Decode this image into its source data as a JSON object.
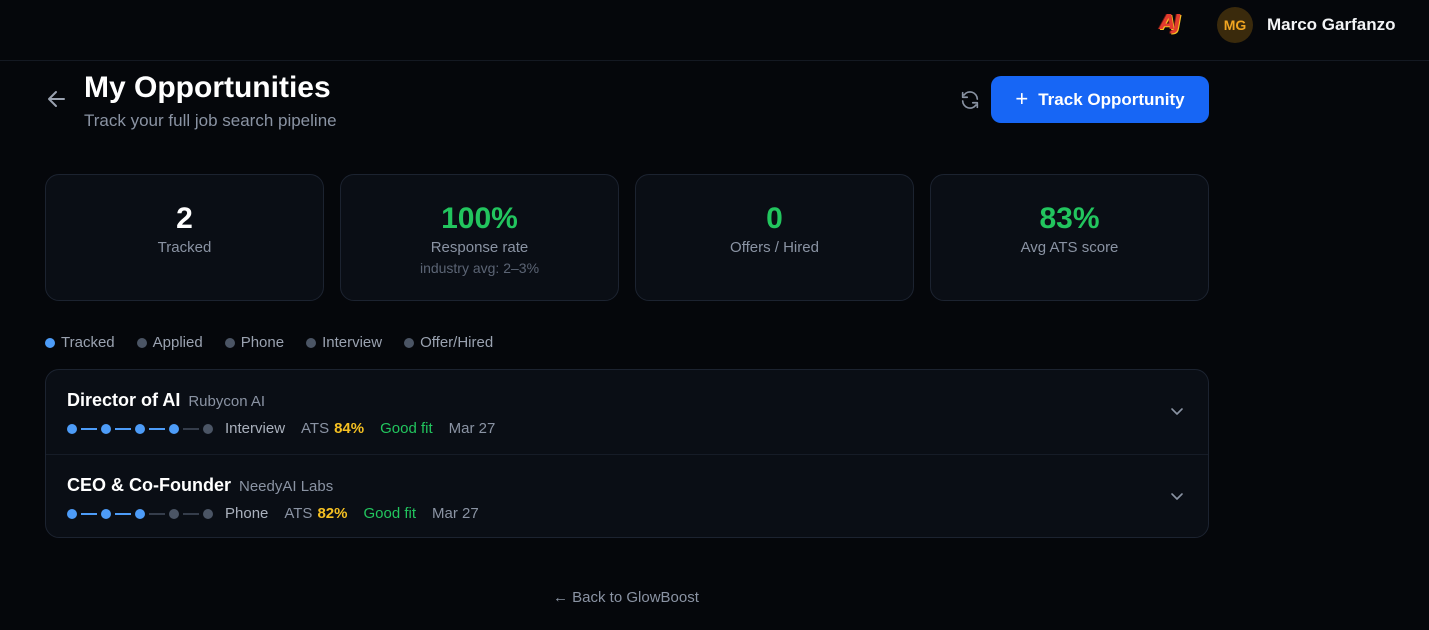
{
  "header": {
    "logo_text": "AJ",
    "user_initials": "MG",
    "user_name": "Marco Garfanzo"
  },
  "page": {
    "title": "My Opportunities",
    "subtitle": "Track your full job search pipeline",
    "track_button_label": "Track Opportunity"
  },
  "stats": [
    {
      "value": "2",
      "label": "Tracked",
      "note": "",
      "color": "#ffffff"
    },
    {
      "value": "100%",
      "label": "Response rate",
      "note": "industry avg: 2–3%",
      "color": "#22c55e"
    },
    {
      "value": "0",
      "label": "Offers / Hired",
      "note": "",
      "color": "#22c55e"
    },
    {
      "value": "83%",
      "label": "Avg ATS score",
      "note": "",
      "color": "#22c55e"
    }
  ],
  "legend": [
    "Tracked",
    "Applied",
    "Phone",
    "Interview",
    "Offer/Hired"
  ],
  "opportunities": [
    {
      "title": "Director of AI",
      "company": "Rubycon AI",
      "stage": "Interview",
      "stage_index": 4,
      "ats_label": "ATS",
      "ats": "84%",
      "fit": "Good fit",
      "date": "Mar 27"
    },
    {
      "title": "CEO & Co-Founder",
      "company": "NeedyAI Labs",
      "stage": "Phone",
      "stage_index": 3,
      "ats_label": "ATS",
      "ats": "82%",
      "fit": "Good fit",
      "date": "Mar 27"
    }
  ],
  "footer": {
    "back_link": "← Back to GlowBoost"
  },
  "colors": {
    "accent": "#1766f5",
    "pipeline_active": "#4d9cf8",
    "success": "#22c55e",
    "ats": "#f5c022"
  }
}
